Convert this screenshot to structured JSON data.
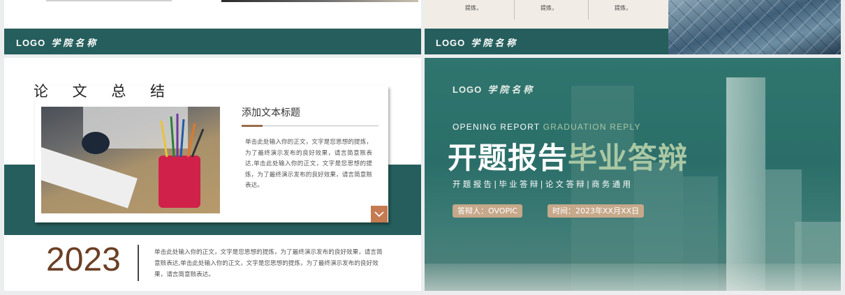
{
  "logo": {
    "text": "LOGO",
    "school": "学院名称"
  },
  "top_right": {
    "cells": [
      "提炼，",
      "提炼，",
      "提炼，"
    ]
  },
  "bottom_left": {
    "title": "论 文 总 结",
    "card_title": "添加文本标题",
    "card_body": "单击此处输入你的正文，文字是您思想的提炼，为了最终演示发布的良好效果，请言简意赅表达,单击此处输入你的正文，文字是您思想的提炼，为了最终演示发布的良好效果，请言简意赅表达。",
    "year": "2023",
    "year_body": "单击此处输入你的正文，文字是您思想的提炼，为了最终演示发布的良好效果，请言简意赅表达,单击此处输入你的正文，文字是您思想的提炼，为了最终演示发布的良好效果，请言简意赅表达。",
    "chevron_icon": "chevron-down-icon"
  },
  "bottom_right": {
    "opening_a": "OPENING REPORT ",
    "opening_b": "GRADUATION REPLY",
    "title_a": "开题报告",
    "title_b": "毕业答辩",
    "subtitle": "开题报告|毕业答辩|论文答辩|商务通用",
    "defender": "答辩人：OVOPIC",
    "time": "时间：2023年XX月XX日"
  },
  "colors": {
    "teal": "#255e5c",
    "accent": "#c57b51",
    "brown": "#6b3f24",
    "light_green": "#a9c7a4"
  }
}
